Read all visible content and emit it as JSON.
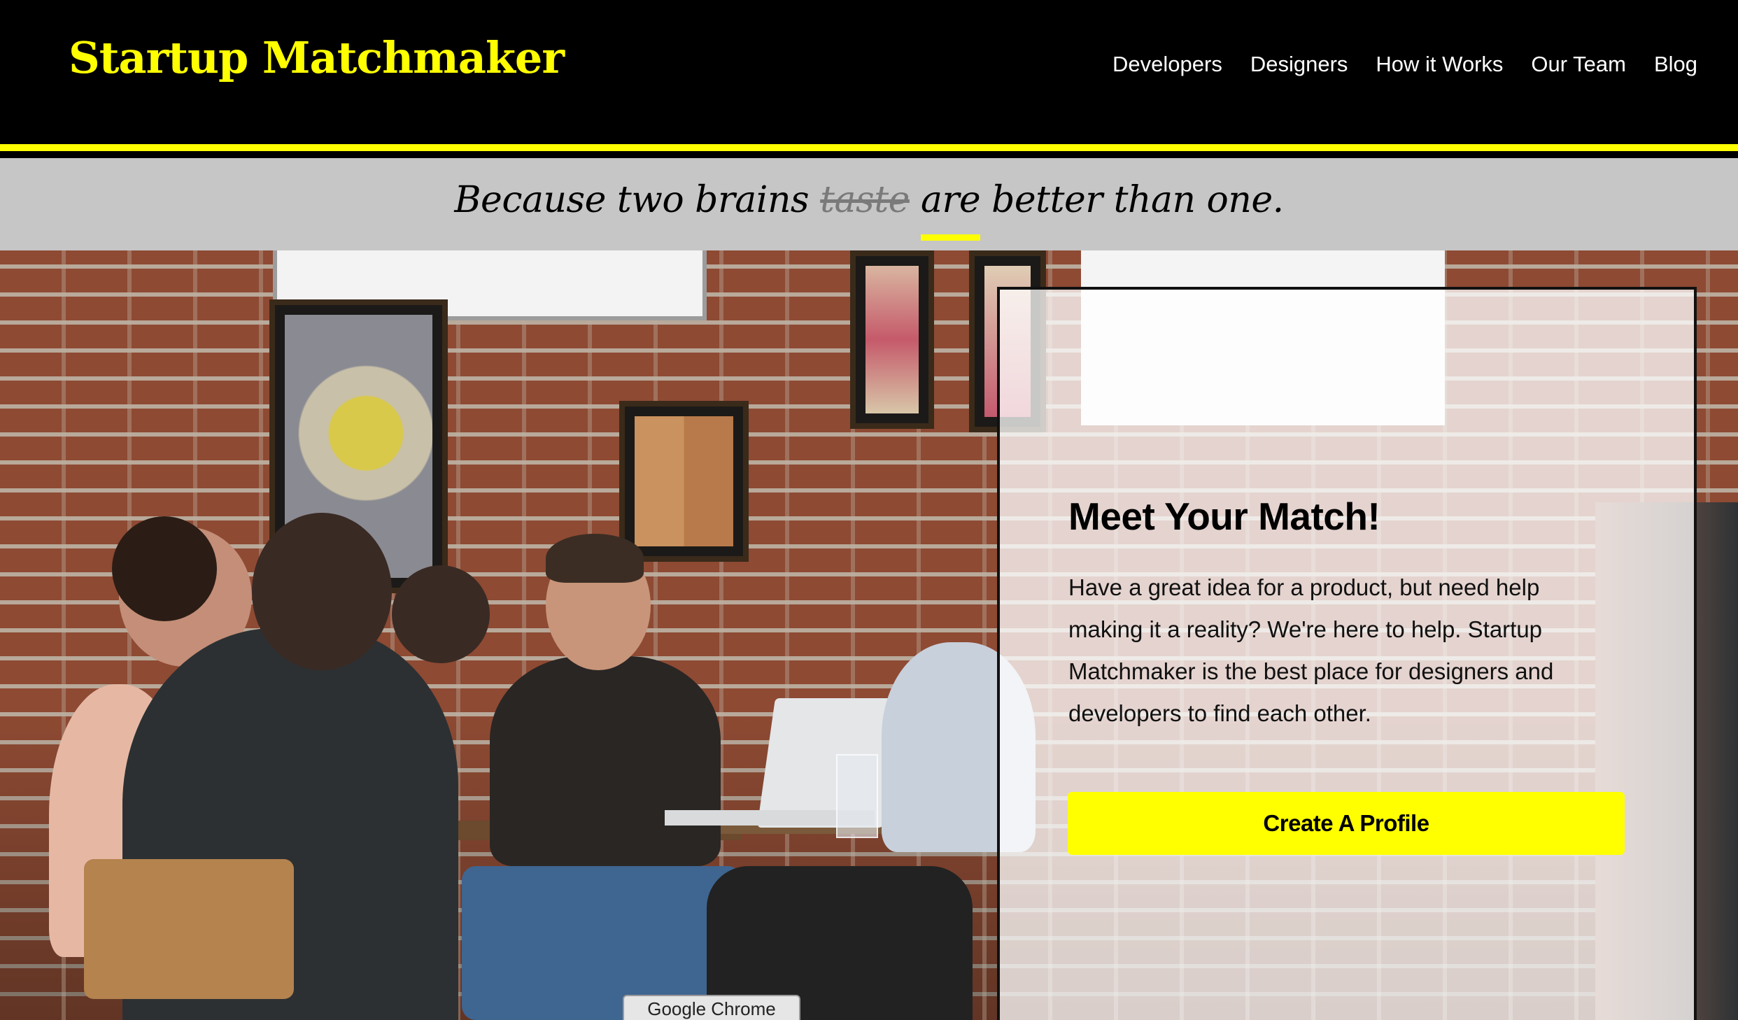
{
  "header": {
    "logo": "Startup Matchmaker",
    "nav": [
      "Developers",
      "Designers",
      "How it Works",
      "Our Team",
      "Blog"
    ]
  },
  "tagline": {
    "before": "Because two brains",
    "struck": "taste",
    "highlight": "are",
    "after": "better than one."
  },
  "card": {
    "title": "Meet Your Match!",
    "body": "Have a great idea for a product, but need help making it a reality? We're here to help. Startup Matchmaker is the best place for designers and developers to find each other.",
    "cta": "Create A Profile"
  },
  "tooltip": "Google Chrome",
  "colors": {
    "accent": "#ffff00",
    "header_bg": "#000000",
    "band_bg": "#c6c6c6"
  }
}
